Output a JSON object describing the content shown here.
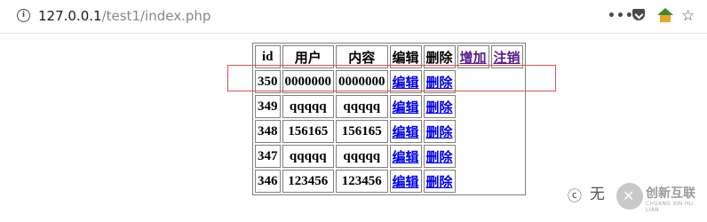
{
  "browser": {
    "url_host": "127.0.0.1",
    "url_path": "/test1/index.php",
    "more_icon": "•••",
    "star_icon": "☆"
  },
  "table": {
    "headers": [
      "id",
      "用户",
      "内容",
      "编辑",
      "删除"
    ],
    "add_link": "增加",
    "logout_link": "注销",
    "edit_label": "编辑",
    "delete_label": "删除",
    "rows": [
      {
        "id": "350",
        "user": "0000000",
        "content": "0000000"
      },
      {
        "id": "349",
        "user": "qqqqq",
        "content": "qqqqq"
      },
      {
        "id": "348",
        "user": "156165",
        "content": "156165"
      },
      {
        "id": "347",
        "user": "qqqqq",
        "content": "qqqqq"
      },
      {
        "id": "346",
        "user": "123456",
        "content": "123456"
      }
    ]
  },
  "watermark": {
    "mark": "ⓒ",
    "text": "无",
    "brand": "创新互联",
    "brand_sub": "CHUANG XIN HU LIAN"
  },
  "colors": {
    "link": "#0000ee",
    "visited_link": "#551a8b",
    "highlight_box": "#d9534f"
  }
}
